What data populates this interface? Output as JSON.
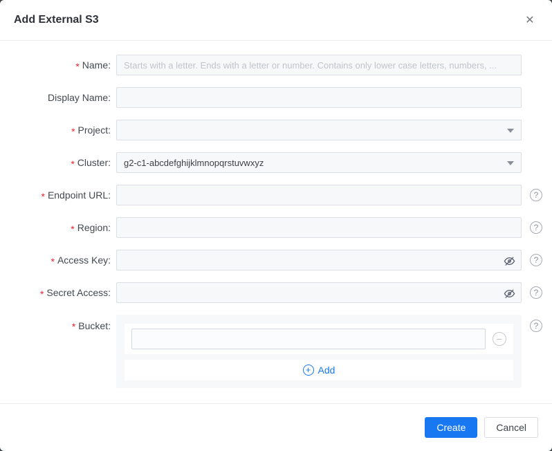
{
  "dialog": {
    "title": "Add External S3"
  },
  "icons": {
    "close": "✕",
    "help": "?",
    "minus": "−",
    "plus": "+"
  },
  "colors": {
    "accent_blue": "#1778f2",
    "required_red": "#f5222d",
    "input_background": "#f7f8fa",
    "panel_background": "#f7f8fa"
  },
  "fields": [
    {
      "star": "*",
      "label": "Name:",
      "placeholder": "Starts with a letter. Ends with a letter or number. Contains only lower case letters, numbers, ...",
      "value": ""
    },
    {
      "star": "",
      "label": "Display Name:",
      "placeholder": "",
      "value": ""
    },
    {
      "star": "*",
      "label": "Project:",
      "value": ""
    },
    {
      "star": "*",
      "label": "Cluster:",
      "value": "g2-c1-abcdefghijklmnopqrstuvwxyz"
    },
    {
      "star": "*",
      "label": "Endpoint URL:",
      "value": ""
    },
    {
      "star": "*",
      "label": "Region:",
      "value": ""
    },
    {
      "star": "*",
      "label": "Access Key:",
      "value": ""
    },
    {
      "star": "*",
      "label": "Secret Access:",
      "value": ""
    },
    {
      "star": "*",
      "label": "Bucket:",
      "item_value": "",
      "add_label": "Add"
    }
  ],
  "footer": {
    "create_label": "Create",
    "cancel_label": "Cancel"
  }
}
